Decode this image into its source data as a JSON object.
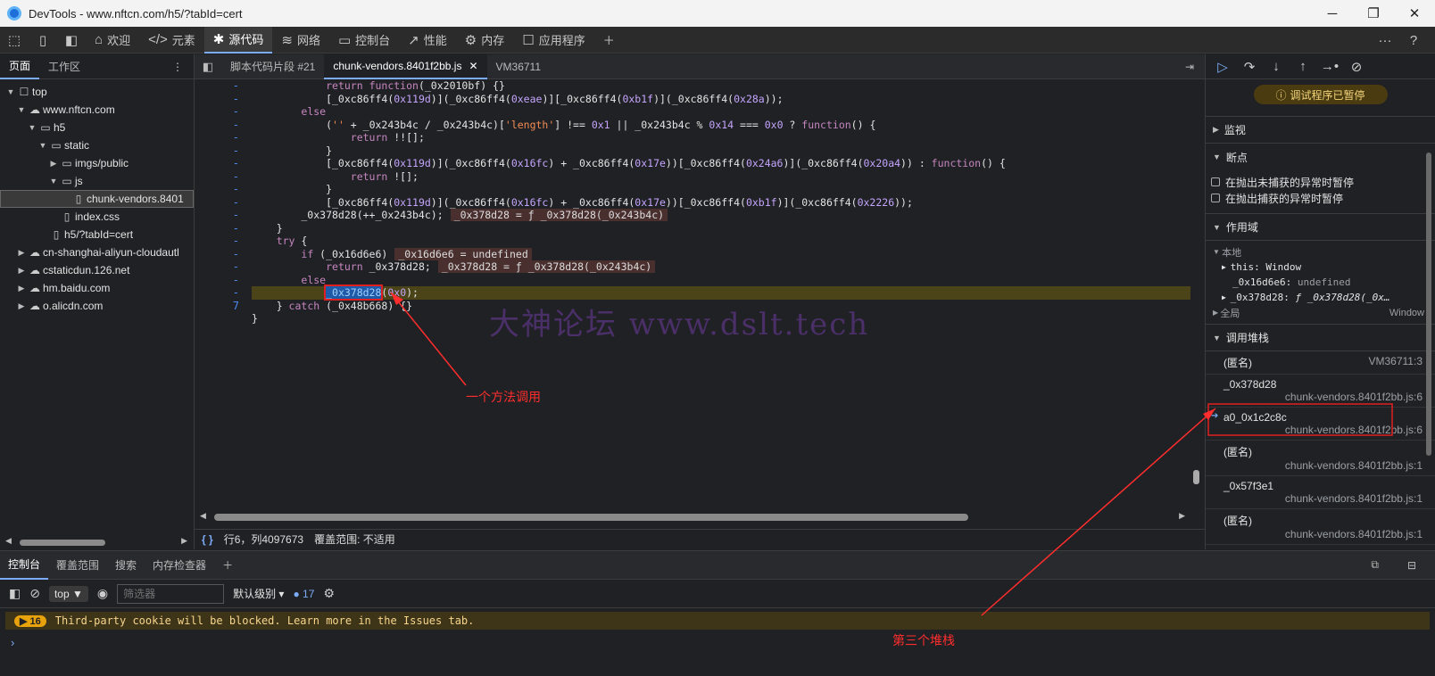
{
  "window": {
    "title": "DevTools - www.nftcn.com/h5/?tabId=cert",
    "controls": [
      "─",
      "❐",
      "✕"
    ]
  },
  "toolbar": {
    "tabs": [
      {
        "icon": "home-icon",
        "glyph": "⌂",
        "label": "欢迎"
      },
      {
        "icon": "code-icon",
        "glyph": "</>",
        "label": "元素"
      },
      {
        "icon": "bug-icon",
        "glyph": "✱",
        "label": "源代码"
      },
      {
        "icon": "wifi-icon",
        "glyph": "≋",
        "label": "网络"
      },
      {
        "icon": "console-icon",
        "glyph": "▭",
        "label": "控制台"
      },
      {
        "icon": "performance-icon",
        "glyph": "↗",
        "label": "性能"
      },
      {
        "icon": "memory-icon",
        "glyph": "⚙",
        "label": "内存"
      },
      {
        "icon": "application-icon",
        "glyph": "☐",
        "label": "应用程序"
      }
    ],
    "more": "···",
    "help": "?"
  },
  "navigator": {
    "tabs": [
      "页面",
      "工作区"
    ],
    "tree": [
      {
        "indent": 0,
        "arrow": "▼",
        "icon": "frame-icon",
        "glyph": "☐",
        "label": "top"
      },
      {
        "indent": 1,
        "arrow": "▼",
        "icon": "cloud-icon",
        "glyph": "☁",
        "label": "www.nftcn.com"
      },
      {
        "indent": 2,
        "arrow": "▼",
        "icon": "folder-icon",
        "glyph": "▭",
        "label": "h5"
      },
      {
        "indent": 3,
        "arrow": "▼",
        "icon": "folder-icon",
        "glyph": "▭",
        "label": "static"
      },
      {
        "indent": 4,
        "arrow": "▶",
        "icon": "folder-icon",
        "glyph": "▭",
        "label": "imgs/public"
      },
      {
        "indent": 4,
        "arrow": "▼",
        "icon": "folder-icon",
        "glyph": "▭",
        "label": "js"
      },
      {
        "indent": 5,
        "arrow": "",
        "icon": "file-icon",
        "glyph": "▯",
        "label": "chunk-vendors.8401",
        "selected": true
      },
      {
        "indent": 4,
        "arrow": "",
        "icon": "file-icon",
        "glyph": "▯",
        "label": "index.css"
      },
      {
        "indent": 3,
        "arrow": "",
        "icon": "file-icon",
        "glyph": "▯",
        "label": "h5/?tabId=cert"
      },
      {
        "indent": 1,
        "arrow": "▶",
        "icon": "cloud-icon",
        "glyph": "☁",
        "label": "cn-shanghai-aliyun-cloudautl"
      },
      {
        "indent": 1,
        "arrow": "▶",
        "icon": "cloud-icon",
        "glyph": "☁",
        "label": "cstaticdun.126.net"
      },
      {
        "indent": 1,
        "arrow": "▶",
        "icon": "cloud-icon",
        "glyph": "☁",
        "label": "hm.baidu.com"
      },
      {
        "indent": 1,
        "arrow": "▶",
        "icon": "cloud-icon",
        "glyph": "☁",
        "label": "o.alicdn.com"
      }
    ]
  },
  "editor": {
    "tabs": [
      {
        "label": "脚本代码片段 #21",
        "active": false
      },
      {
        "label": "chunk-vendors.8401f2bb.js",
        "active": true,
        "close": "✕"
      },
      {
        "label": "VM36711",
        "active": false
      }
    ],
    "gutter": [
      "-",
      "-",
      "-",
      "-",
      "-",
      "-",
      "-",
      "-",
      "-",
      "-",
      "-",
      "-",
      "-",
      "-",
      "-",
      "-",
      "-",
      "7"
    ],
    "status": {
      "braces": "{ }",
      "position": "行6，列4097673",
      "coverage": "覆盖范围: 不适用"
    },
    "watermark": "大神论坛  www.dslt.tech",
    "annotation_call": "一个方法调用",
    "annotation_stack": "第三个堆栈"
  },
  "code": [
    [
      [
        "            "
      ],
      [
        "kw",
        "return "
      ],
      [
        "kw",
        "function"
      ],
      [
        "",
        "(_0x2010bf) {}"
      ]
    ],
    [
      [
        "            [_0xc86ff4("
      ],
      [
        "num",
        "0x119d"
      ],
      [
        "",
        ")](_0xc86ff4("
      ],
      [
        "num",
        "0xeae"
      ],
      [
        "",
        ")][_0xc86ff4("
      ],
      [
        "num",
        "0xb1f"
      ],
      [
        "",
        ")](_0xc86ff4("
      ],
      [
        "num",
        "0x28a"
      ],
      [
        "",
        "));"
      ]
    ],
    [
      [
        "        "
      ],
      [
        "kw",
        "else"
      ]
    ],
    [
      [
        "            ("
      ],
      [
        "str",
        "''"
      ],
      [
        "",
        " + _0x243b4c / _0x243b4c)["
      ],
      [
        "str",
        "'length'"
      ],
      [
        "",
        "] !== "
      ],
      [
        "num",
        "0x1"
      ],
      [
        "",
        " || _0x243b4c % "
      ],
      [
        "num",
        "0x14"
      ],
      [
        "",
        " === "
      ],
      [
        "num",
        "0x0"
      ],
      [
        "",
        " ? "
      ],
      [
        "kw",
        "function"
      ],
      [
        "",
        "() {"
      ]
    ],
    [
      [
        "                "
      ],
      [
        "kw",
        "return "
      ],
      [
        "",
        "!![];"
      ]
    ],
    [
      [
        "            }"
      ]
    ],
    [
      [
        "            [_0xc86ff4("
      ],
      [
        "num",
        "0x119d"
      ],
      [
        "",
        ")](_0xc86ff4("
      ],
      [
        "num",
        "0x16fc"
      ],
      [
        "",
        ") + _0xc86ff4("
      ],
      [
        "num",
        "0x17e"
      ],
      [
        "",
        "))[_0xc86ff4("
      ],
      [
        "num",
        "0x24a6"
      ],
      [
        "",
        ")](_0xc86ff4("
      ],
      [
        "num",
        "0x20a4"
      ],
      [
        "",
        ")) : "
      ],
      [
        "kw",
        "function"
      ],
      [
        "",
        "() {"
      ]
    ],
    [
      [
        "                "
      ],
      [
        "kw",
        "return "
      ],
      [
        "",
        "![];"
      ]
    ],
    [
      [
        "            }"
      ]
    ],
    [
      [
        "            [_0xc86ff4("
      ],
      [
        "num",
        "0x119d"
      ],
      [
        "",
        ")](_0xc86ff4("
      ],
      [
        "num",
        "0x16fc"
      ],
      [
        "",
        ") + _0xc86ff4("
      ],
      [
        "num",
        "0x17e"
      ],
      [
        "",
        "))[_0xc86ff4("
      ],
      [
        "num",
        "0xb1f"
      ],
      [
        "",
        ")](_0xc86ff4("
      ],
      [
        "num",
        "0x2226"
      ],
      [
        "",
        "));"
      ]
    ],
    [
      [
        "        _0x378d28(++_0x243b4c);"
      ],
      [
        "inl",
        "_0x378d28 = ƒ _0x378d28(_0x243b4c)"
      ]
    ],
    [
      [
        "    }"
      ]
    ],
    [
      [
        "    "
      ],
      [
        "kw",
        "try"
      ],
      [
        "",
        " {"
      ]
    ],
    [
      [
        "        "
      ],
      [
        "kw",
        "if"
      ],
      [
        "",
        " (_0x16d6e6)"
      ],
      [
        "inl",
        "_0x16d6e6 = undefined"
      ]
    ],
    [
      [
        "            "
      ],
      [
        "kw",
        "return"
      ],
      [
        "",
        " _0x378d28;"
      ],
      [
        "inl",
        "_0x378d28 = ƒ _0x378d28(_0x243b4c)"
      ]
    ],
    [
      [
        "        "
      ],
      [
        "kw",
        "else"
      ]
    ],
    [
      [
        "            "
      ],
      [
        "sel",
        "_0x378d28"
      ],
      [
        "",
        "("
      ],
      [
        "num",
        "0x0"
      ],
      [
        "",
        ");"
      ]
    ],
    [
      [
        "    } "
      ],
      [
        "kw",
        "catch"
      ],
      [
        "",
        " (_0x48b668) {}"
      ]
    ],
    [
      [
        "}"
      ]
    ]
  ],
  "debugger": {
    "toolbar": [
      "▷",
      "↷",
      "↓",
      "↑",
      "→•",
      "⊘"
    ],
    "paused": "调试程序已暂停",
    "sections": {
      "watch": "监视",
      "breakpoints": "断点",
      "scope": "作用域",
      "callstack": "调用堆栈"
    },
    "checkboxes": [
      "在抛出未捕获的异常时暂停",
      "在抛出捕获的异常时暂停"
    ],
    "scope": {
      "local": "本地",
      "this_key": "this",
      "this_val": "Window",
      "v1_key": "_0x16d6e6",
      "v1_val": "undefined",
      "v2_key": "_0x378d28",
      "v2_val": "ƒ _0x378d28(_0x…",
      "global": "全局",
      "global_val": "Window"
    },
    "frames": [
      {
        "name": "(匿名)",
        "loc": "VM36711:3",
        "file": ""
      },
      {
        "name": "_0x378d28",
        "loc": "",
        "file": "chunk-vendors.8401f2bb.js:6"
      },
      {
        "name": "a0_0x1c2c8c",
        "loc": "",
        "file": "chunk-vendors.8401f2bb.js:6",
        "current": true
      },
      {
        "name": "(匿名)",
        "loc": "",
        "file": "chunk-vendors.8401f2bb.js:1"
      },
      {
        "name": "_0x57f3e1",
        "loc": "",
        "file": "chunk-vendors.8401f2bb.js:1"
      },
      {
        "name": "(匿名)",
        "loc": "",
        "file": "chunk-vendors.8401f2bb.js:1"
      },
      {
        "name": "(匿名)",
        "loc": "",
        "file": ""
      }
    ]
  },
  "drawer": {
    "tabs": [
      "控制台",
      "覆盖范围",
      "搜索",
      "内存检查器"
    ],
    "context": "top ▼",
    "filter_placeholder": "筛选器",
    "level": "默认级别 ▾",
    "issue_count": "17",
    "warning_count": "16",
    "warning": "Third-party cookie will be blocked. Learn more in the Issues tab.",
    "prompt": "›"
  }
}
